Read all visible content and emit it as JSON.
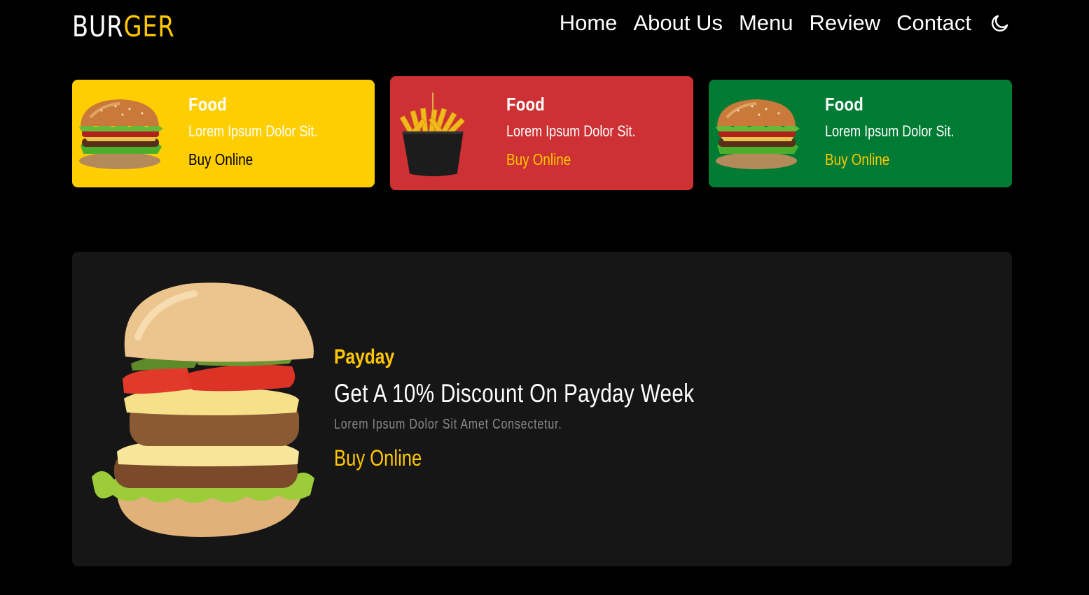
{
  "header": {
    "logo_part1": "BUR",
    "logo_part2": "GER",
    "nav": [
      "Home",
      "About Us",
      "Menu",
      "Review",
      "Contact"
    ],
    "theme_icon": "moon-icon"
  },
  "cards": [
    {
      "title": "Food",
      "description": "Lorem Ipsum Dolor Sit.",
      "link": "Buy Online",
      "bg": "#ffce00",
      "link_color": "#000000",
      "image": "burger-image"
    },
    {
      "title": "Food",
      "description": "Lorem Ipsum Dolor Sit.",
      "link": "Buy Online",
      "bg": "#cd3134",
      "link_color": "#ffc700",
      "image": "fries-image"
    },
    {
      "title": "Food",
      "description": "Lorem Ipsum Dolor Sit.",
      "link": "Buy Online",
      "bg": "#007b34",
      "link_color": "#ffc700",
      "image": "burger-image"
    }
  ],
  "promo": {
    "tag": "Payday",
    "headline": "Get A 10% Discount On Payday Week",
    "subtext": "Lorem Ipsum Dolor Sit Amet Consectetur.",
    "link": "Buy Online",
    "image": "double-burger-image"
  },
  "colors": {
    "accent": "#ffc700",
    "background": "#000000",
    "panel": "#161616"
  }
}
